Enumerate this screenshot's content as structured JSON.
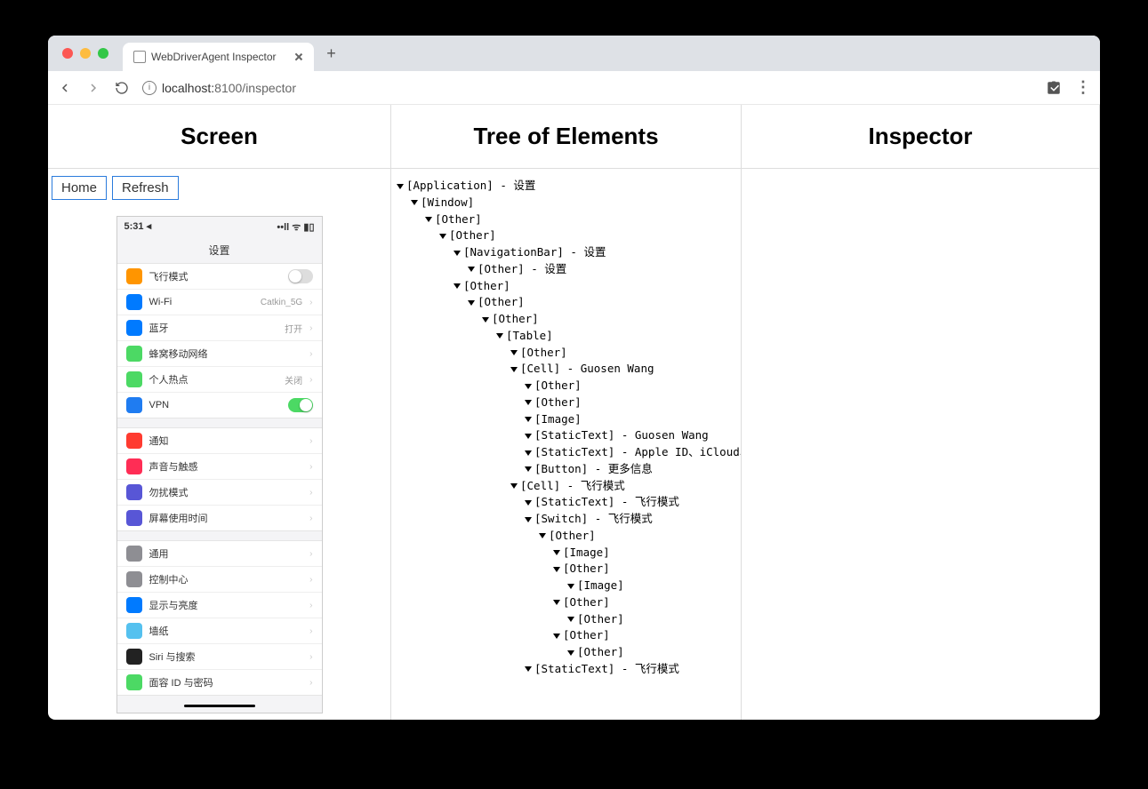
{
  "browser": {
    "tab_title": "WebDriverAgent Inspector",
    "url_host": "localhost:",
    "url_port_path": "8100/inspector"
  },
  "columns": {
    "screen": "Screen",
    "tree": "Tree of Elements",
    "inspector": "Inspector"
  },
  "buttons": {
    "home": "Home",
    "refresh": "Refresh"
  },
  "phone": {
    "time": "5:31 ◂",
    "signal": "••ll ᯤ ▮▯",
    "nav_title": "设置",
    "sections": [
      [
        {
          "icon": "#ff9500",
          "label": "飞行模式",
          "value": "",
          "switch": "off"
        },
        {
          "icon": "#007aff",
          "label": "Wi-Fi",
          "value": "Catkin_5G",
          "chevron": true
        },
        {
          "icon": "#007aff",
          "label": "蓝牙",
          "value": "打开",
          "chevron": true
        },
        {
          "icon": "#4cd964",
          "label": "蜂窝移动网络",
          "value": "",
          "chevron": true
        },
        {
          "icon": "#4cd964",
          "label": "个人热点",
          "value": "关闭",
          "chevron": true
        },
        {
          "icon": "#1f7cf1",
          "label": "VPN",
          "value": "",
          "switch": "on"
        }
      ],
      [
        {
          "icon": "#ff3b30",
          "label": "通知",
          "value": "",
          "chevron": true
        },
        {
          "icon": "#ff2d55",
          "label": "声音与触感",
          "value": "",
          "chevron": true
        },
        {
          "icon": "#5856d6",
          "label": "勿扰模式",
          "value": "",
          "chevron": true
        },
        {
          "icon": "#5856d6",
          "label": "屏幕使用时间",
          "value": "",
          "chevron": true
        }
      ],
      [
        {
          "icon": "#8e8e93",
          "label": "通用",
          "value": "",
          "chevron": true
        },
        {
          "icon": "#8e8e93",
          "label": "控制中心",
          "value": "",
          "chevron": true
        },
        {
          "icon": "#007aff",
          "label": "显示与亮度",
          "value": "",
          "chevron": true
        },
        {
          "icon": "#55c1ef",
          "label": "墙纸",
          "value": "",
          "chevron": true
        },
        {
          "icon": "#222",
          "label": "Siri 与搜索",
          "value": "",
          "chevron": true
        },
        {
          "icon": "#4cd964",
          "label": "面容 ID 与密码",
          "value": "",
          "chevron": true
        }
      ]
    ]
  },
  "tree": [
    {
      "d": 0,
      "t": "[Application] - 设置"
    },
    {
      "d": 1,
      "t": "[Window]"
    },
    {
      "d": 2,
      "t": "[Other]"
    },
    {
      "d": 3,
      "t": "[Other]"
    },
    {
      "d": 4,
      "t": "[NavigationBar] - 设置"
    },
    {
      "d": 5,
      "t": "[Other] - 设置"
    },
    {
      "d": 4,
      "t": "[Other]"
    },
    {
      "d": 5,
      "t": "[Other]"
    },
    {
      "d": 6,
      "t": "[Other]"
    },
    {
      "d": 7,
      "t": "[Table]"
    },
    {
      "d": 8,
      "t": "[Other]"
    },
    {
      "d": 8,
      "t": "[Cell] - Guosen Wang"
    },
    {
      "d": 9,
      "t": "[Other]"
    },
    {
      "d": 9,
      "t": "[Other]"
    },
    {
      "d": 9,
      "t": "[Image]"
    },
    {
      "d": 9,
      "t": "[StaticText] - Guosen Wang"
    },
    {
      "d": 9,
      "t": "[StaticText] - Apple ID、iCloud、iTunes 与 App Store"
    },
    {
      "d": 9,
      "t": "[Button] - 更多信息"
    },
    {
      "d": 8,
      "t": "[Cell] - 飞行模式"
    },
    {
      "d": 9,
      "t": "[StaticText] - 飞行模式"
    },
    {
      "d": 9,
      "t": "[Switch] - 飞行模式"
    },
    {
      "d": 10,
      "t": "[Other]"
    },
    {
      "d": 11,
      "t": "[Image]"
    },
    {
      "d": 11,
      "t": "[Other]"
    },
    {
      "d": 12,
      "t": "[Image]"
    },
    {
      "d": 11,
      "t": "[Other]"
    },
    {
      "d": 12,
      "t": "[Other]"
    },
    {
      "d": 11,
      "t": "[Other]"
    },
    {
      "d": 12,
      "t": "[Other]"
    },
    {
      "d": 9,
      "t": "[StaticText] - 飞行模式"
    }
  ]
}
